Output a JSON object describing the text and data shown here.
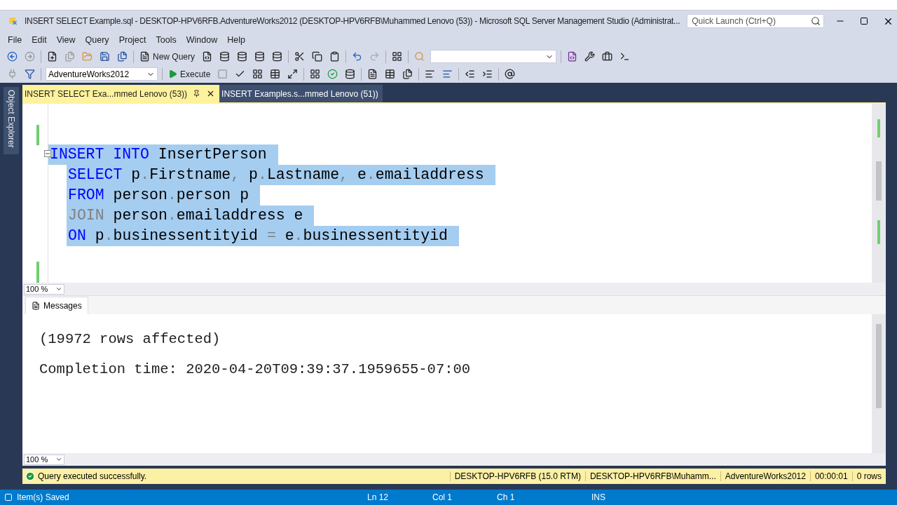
{
  "window": {
    "title": "INSERT SELECT Example.sql - DESKTOP-HPV6RFB.AdventureWorks2012 (DESKTOP-HPV6RFB\\Muhammed Lenovo (53)) - Microsoft SQL Server Management Studio (Administrat...",
    "quick_launch": {
      "placeholder": "Quick Launch (Ctrl+Q)"
    }
  },
  "menu": [
    "File",
    "Edit",
    "View",
    "Query",
    "Project",
    "Tools",
    "Window",
    "Help"
  ],
  "toolbar": {
    "new_query": "New Query",
    "database": "AdventureWorks2012",
    "execute": "Execute"
  },
  "side_tab": "Object Explorer",
  "tabs": [
    {
      "label": "INSERT SELECT Exa...mmed Lenovo (53))",
      "selected": true
    },
    {
      "label": "INSERT Examples.s...mmed Lenovo (51))",
      "selected": false
    }
  ],
  "editor": {
    "zoom": "100 %",
    "lines": [
      {
        "indented": false,
        "tokens": [
          {
            "kind": "keyword",
            "text": "INSERT INTO"
          },
          {
            "kind": "ident",
            "text": " InsertPerson"
          }
        ]
      },
      {
        "indented": true,
        "tokens": [
          {
            "kind": "keyword",
            "text": "SELECT"
          },
          {
            "kind": "ident",
            "text": " p"
          },
          {
            "kind": "operator",
            "text": "."
          },
          {
            "kind": "ident",
            "text": "Firstname"
          },
          {
            "kind": "operator",
            "text": ","
          },
          {
            "kind": "ident",
            "text": " p"
          },
          {
            "kind": "operator",
            "text": "."
          },
          {
            "kind": "ident",
            "text": "Lastname"
          },
          {
            "kind": "operator",
            "text": ","
          },
          {
            "kind": "ident",
            "text": " e"
          },
          {
            "kind": "operator",
            "text": "."
          },
          {
            "kind": "ident",
            "text": "emailaddress"
          }
        ]
      },
      {
        "indented": true,
        "tokens": [
          {
            "kind": "keyword",
            "text": "FROM"
          },
          {
            "kind": "ident",
            "text": " person"
          },
          {
            "kind": "operator",
            "text": "."
          },
          {
            "kind": "ident",
            "text": "person p"
          }
        ]
      },
      {
        "indented": true,
        "tokens": [
          {
            "kind": "operator",
            "text": "JOIN"
          },
          {
            "kind": "ident",
            "text": " person"
          },
          {
            "kind": "operator",
            "text": "."
          },
          {
            "kind": "ident",
            "text": "emailaddress e"
          }
        ]
      },
      {
        "indented": true,
        "tokens": [
          {
            "kind": "keyword",
            "text": "ON"
          },
          {
            "kind": "ident",
            "text": " p"
          },
          {
            "kind": "operator",
            "text": "."
          },
          {
            "kind": "ident",
            "text": "businessentityid "
          },
          {
            "kind": "operator",
            "text": "="
          },
          {
            "kind": "ident",
            "text": " e"
          },
          {
            "kind": "operator",
            "text": "."
          },
          {
            "kind": "ident",
            "text": "businessentityid"
          }
        ]
      }
    ]
  },
  "results": {
    "tab": "Messages",
    "zoom": "100 %",
    "lines": [
      "(19972 rows affected)",
      "Completion time: 2020-04-20T09:39:37.1959655-07:00"
    ]
  },
  "query_status": {
    "message": "Query executed successfully.",
    "cells": [
      "DESKTOP-HPV6RFB (15.0 RTM)",
      "DESKTOP-HPV6RFB\\Muhamm...",
      "AdventureWorks2012",
      "00:00:01",
      "0 rows"
    ]
  },
  "status_bar": {
    "message": "Item(s) Saved",
    "cells": [
      "Ln 12",
      "Col 1",
      "Ch 1",
      "INS"
    ]
  }
}
